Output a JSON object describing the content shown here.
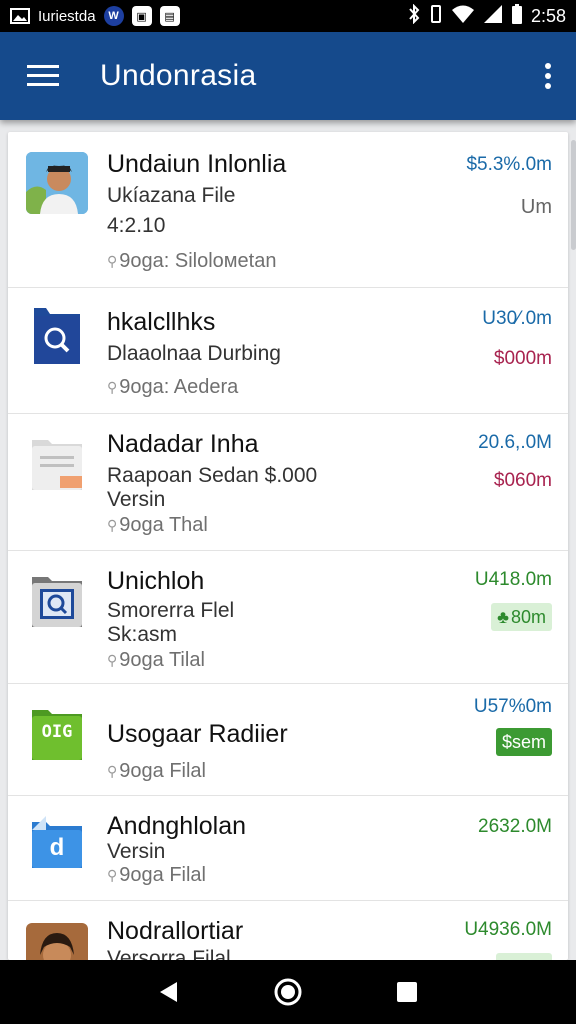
{
  "status_bar": {
    "carrier": "Iuriestda",
    "time": "2:58",
    "icons": [
      "image-icon",
      "vpn-icon",
      "app-icon",
      "app-icon",
      "bluetooth-icon",
      "vibrate-icon",
      "wifi-icon",
      "signal-icon",
      "battery-icon"
    ]
  },
  "app_bar": {
    "title": "Undonrasia",
    "menu_icon": "hamburger-icon",
    "overflow_icon": "more-vert-icon"
  },
  "list": [
    {
      "title": "Undaiun Inlonlia",
      "subtitle": "Ukíazana File",
      "subtitle2": "4:2.10",
      "meta": "9oga: Siloloмetan",
      "amount": "$5.3%.0m",
      "amount2": "Um",
      "thumb": "avatar",
      "amount_color": "#1a6aa8"
    },
    {
      "title": "hkalcllhks",
      "subtitle": "Dlaaolnaa Durbing",
      "meta": "9oga: Aedera",
      "amount": "U30⁄.0m",
      "amount2": "$000m",
      "thumb": "search-folder",
      "amount_color": "#1a6aa8",
      "amount2_color": "#a8234f"
    },
    {
      "title": "Nadadar Inha",
      "subtitle": "Raapoan Sedan $.000",
      "subtitle2": "Versin",
      "meta": "9oga Thal",
      "amount": "20.6,.0M",
      "amount2": "$060m",
      "thumb": "document",
      "amount_color": "#1a6aa8",
      "amount2_color": "#a8234f"
    },
    {
      "title": "Unichloh",
      "subtitle": "Smorerra Flel",
      "subtitle2": "Sk:asm",
      "meta": "9oga Tilal",
      "amount": "U418.0m",
      "amount2": "80m",
      "thumb": "search-window",
      "amount_color": "#2d8a2d",
      "pill_style": "light-green"
    },
    {
      "title": "Usogaar Radiier",
      "meta": "9oga Filal",
      "amount": "U57%0m",
      "amount2": "$sem",
      "thumb": "green-tile",
      "thumb_label": "OIG",
      "amount_color": "#1a6aa8",
      "pill_style": "solid-green"
    },
    {
      "title": "Andnghlolan",
      "subtitle": "Versin",
      "meta": "9oga Filal",
      "amount": "2632.0M",
      "thumb": "blue-folder",
      "thumb_label": "d",
      "amount_color": "#2d8a2d"
    },
    {
      "title": "Nodrallortiar",
      "subtitle": "Versorra Filal",
      "amount": "U4936.0M",
      "thumb": "avatar",
      "amount_color": "#2d8a2d"
    }
  ],
  "nav_bar": {
    "back_icon": "back-triangle-icon",
    "home_icon": "home-circle-icon",
    "recents_icon": "recents-square-icon"
  },
  "colors": {
    "app_bar": "#154a8c",
    "status_bar": "#000000",
    "blue_amount": "#1a6aa8",
    "red_amount": "#a8234f",
    "green_amount": "#2d8a2d"
  }
}
